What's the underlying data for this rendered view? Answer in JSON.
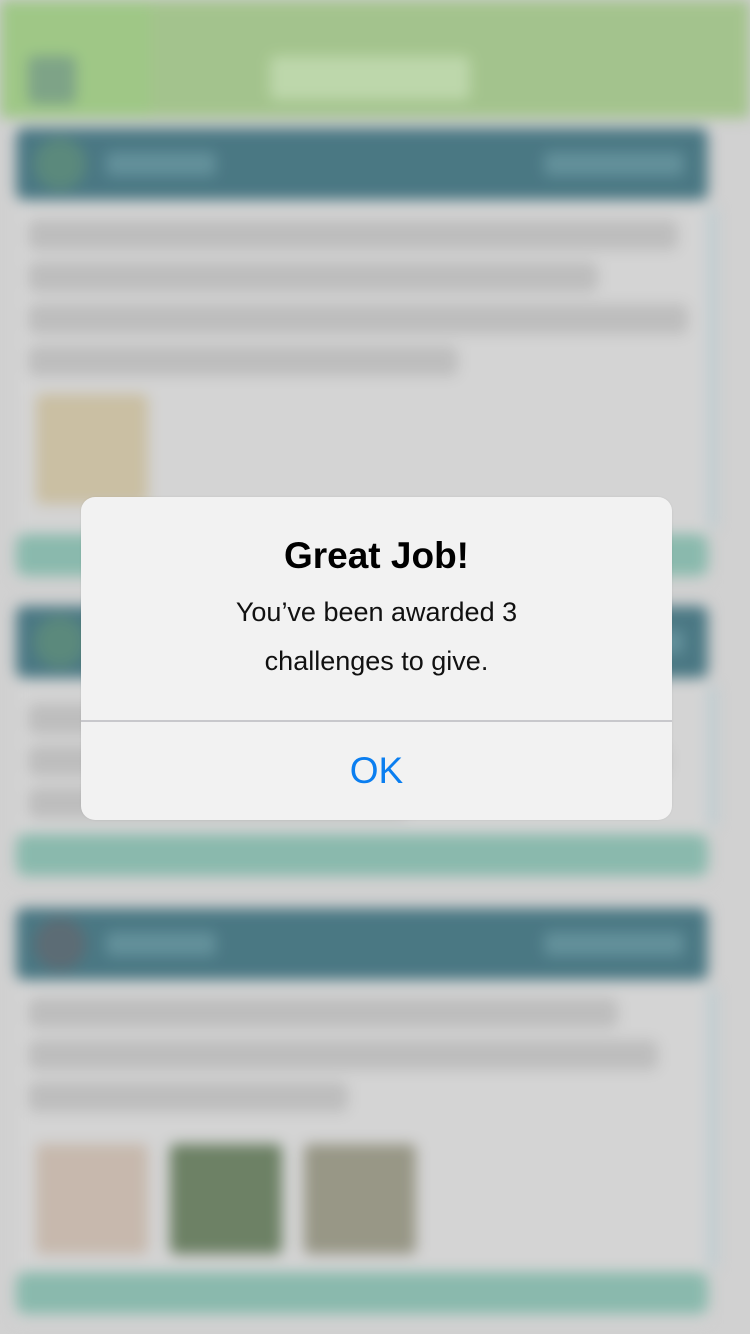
{
  "alert": {
    "title": "Great Job!",
    "message_line_1": "You’ve been awarded 3",
    "message_line_2": "challenges to give.",
    "ok_label": "OK"
  },
  "colors": {
    "nav_bar": "#9cc57f",
    "card_header": "#2a6473",
    "card_footer": "#7bb8a8",
    "alert_background": "#f2f2f2",
    "alert_button_text": "#0a7ef0"
  },
  "icons": {
    "menu": "menu-icon",
    "avatar": "avatar-icon",
    "add": "plus-icon"
  }
}
